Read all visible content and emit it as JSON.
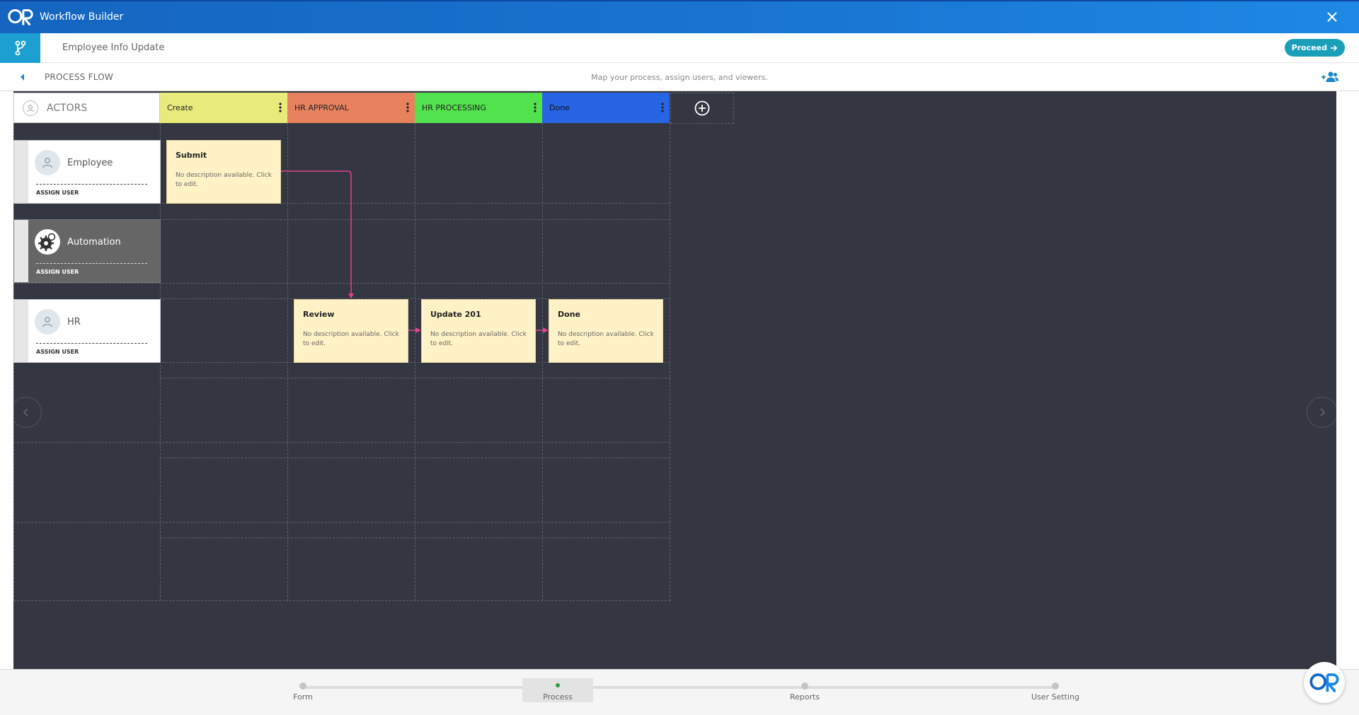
{
  "window": {
    "title": "Workflow Builder",
    "close_icon": "close-icon",
    "logo_icon": "qr-logo-icon"
  },
  "header": {
    "document_title": "Employee Info Update",
    "proceed_label": "Proceed",
    "branch_icon": "branch-icon"
  },
  "subheader": {
    "section_title": "PROCESS FLOW",
    "hint": "Map your process, assign users, and viewers.",
    "add_viewer_icon": "add-users-icon"
  },
  "actors_header": {
    "label": "ACTORS"
  },
  "stages": [
    {
      "label": "Create",
      "color": "#e9ea7c"
    },
    {
      "label": "HR APPROVAL",
      "color": "#e8825e"
    },
    {
      "label": "HR PROCESSING",
      "color": "#52e24e"
    },
    {
      "label": "Done",
      "color": "#2765e5"
    }
  ],
  "actors": [
    {
      "name": "Employee",
      "assign_label": "ASSIGN USER",
      "theme": "light"
    },
    {
      "name": "Automation",
      "assign_label": "ASSIGN USER",
      "theme": "dark"
    },
    {
      "name": "HR",
      "assign_label": "ASSIGN USER",
      "theme": "light"
    }
  ],
  "steps": [
    {
      "title": "Submit",
      "description": "No description available. Click to edit.",
      "stage": "Create",
      "actor": "Employee"
    },
    {
      "title": "Review",
      "description": "No description available. Click to edit.",
      "stage": "HR APPROVAL",
      "actor": "HR"
    },
    {
      "title": "Update 201",
      "description": "No description available. Click to edit.",
      "stage": "HR PROCESSING",
      "actor": "HR"
    },
    {
      "title": "Done",
      "description": "No description available. Click to edit.",
      "stage": "Done",
      "actor": "HR"
    }
  ],
  "connector_color": "#e0428f",
  "footer": {
    "steps": [
      {
        "label": "Form",
        "active": false
      },
      {
        "label": "Process",
        "active": true
      },
      {
        "label": "Reports",
        "active": false
      },
      {
        "label": "User Setting",
        "active": false
      }
    ],
    "active_color": "#2e9e44"
  }
}
